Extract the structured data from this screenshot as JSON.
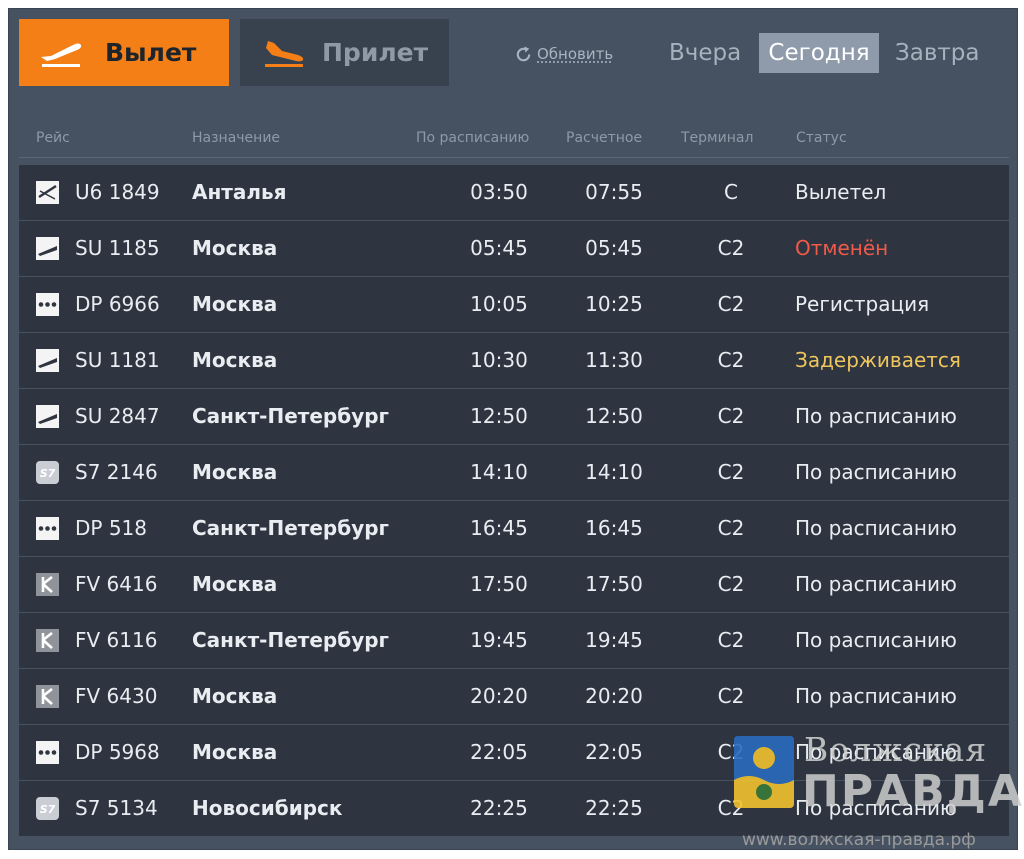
{
  "tabs": {
    "departures": "Вылет",
    "arrivals": "Прилет"
  },
  "refresh_label": "Обновить",
  "days": {
    "yesterday": "Вчера",
    "today": "Сегодня",
    "tomorrow": "Завтра",
    "selected": "today"
  },
  "columns": {
    "flight": "Рейс",
    "destination": "Назначение",
    "scheduled": "По расписанию",
    "estimated": "Расчетное",
    "terminal": "Терминал",
    "status": "Статус"
  },
  "colors": {
    "accent": "#f57f17",
    "status_cancelled": "#ef5a4a",
    "status_delayed": "#efc55e"
  },
  "flights": [
    {
      "airline_icon": "airline-u6-logo-icon",
      "flight": "U6 1849",
      "destination": "Анталья",
      "scheduled": "03:50",
      "estimated": "07:55",
      "terminal": "C",
      "status": "Вылетел",
      "status_type": "normal"
    },
    {
      "airline_icon": "airline-su-logo-icon",
      "flight": "SU 1185",
      "destination": "Москва",
      "scheduled": "05:45",
      "estimated": "05:45",
      "terminal": "C2",
      "status": "Отменён",
      "status_type": "cancelled"
    },
    {
      "airline_icon": "airline-dp-logo-icon",
      "flight": "DP 6966",
      "destination": "Москва",
      "scheduled": "10:05",
      "estimated": "10:25",
      "terminal": "C2",
      "status": "Регистрация",
      "status_type": "normal"
    },
    {
      "airline_icon": "airline-su-logo-icon",
      "flight": "SU 1181",
      "destination": "Москва",
      "scheduled": "10:30",
      "estimated": "11:30",
      "terminal": "C2",
      "status": "Задерживается",
      "status_type": "delayed"
    },
    {
      "airline_icon": "airline-su-logo-icon",
      "flight": "SU 2847",
      "destination": "Санкт-Петербург",
      "scheduled": "12:50",
      "estimated": "12:50",
      "terminal": "C2",
      "status": "По расписанию",
      "status_type": "normal"
    },
    {
      "airline_icon": "airline-s7-logo-icon",
      "flight": "S7 2146",
      "destination": "Москва",
      "scheduled": "14:10",
      "estimated": "14:10",
      "terminal": "C2",
      "status": "По расписанию",
      "status_type": "normal"
    },
    {
      "airline_icon": "airline-dp-logo-icon",
      "flight": "DP 518",
      "destination": "Санкт-Петербург",
      "scheduled": "16:45",
      "estimated": "16:45",
      "terminal": "C2",
      "status": "По расписанию",
      "status_type": "normal"
    },
    {
      "airline_icon": "airline-fv-logo-icon",
      "flight": "FV 6416",
      "destination": "Москва",
      "scheduled": "17:50",
      "estimated": "17:50",
      "terminal": "C2",
      "status": "По расписанию",
      "status_type": "normal"
    },
    {
      "airline_icon": "airline-fv-logo-icon",
      "flight": "FV 6116",
      "destination": "Санкт-Петербург",
      "scheduled": "19:45",
      "estimated": "19:45",
      "terminal": "C2",
      "status": "По расписанию",
      "status_type": "normal"
    },
    {
      "airline_icon": "airline-fv-logo-icon",
      "flight": "FV 6430",
      "destination": "Москва",
      "scheduled": "20:20",
      "estimated": "20:20",
      "terminal": "C2",
      "status": "По расписанию",
      "status_type": "normal"
    },
    {
      "airline_icon": "airline-dp-logo-icon",
      "flight": "DP 5968",
      "destination": "Москва",
      "scheduled": "22:05",
      "estimated": "22:05",
      "terminal": "C2",
      "status": "По расписанию",
      "status_type": "normal"
    },
    {
      "airline_icon": "airline-s7-logo-icon",
      "flight": "S7 5134",
      "destination": "Новосибирск",
      "scheduled": "22:25",
      "estimated": "22:25",
      "terminal": "C2",
      "status": "По расписанию",
      "status_type": "normal"
    }
  ],
  "watermark": {
    "line1": "Волжская",
    "line2": "ПРАВДА",
    "url": "www.волжская-правда.рф"
  }
}
